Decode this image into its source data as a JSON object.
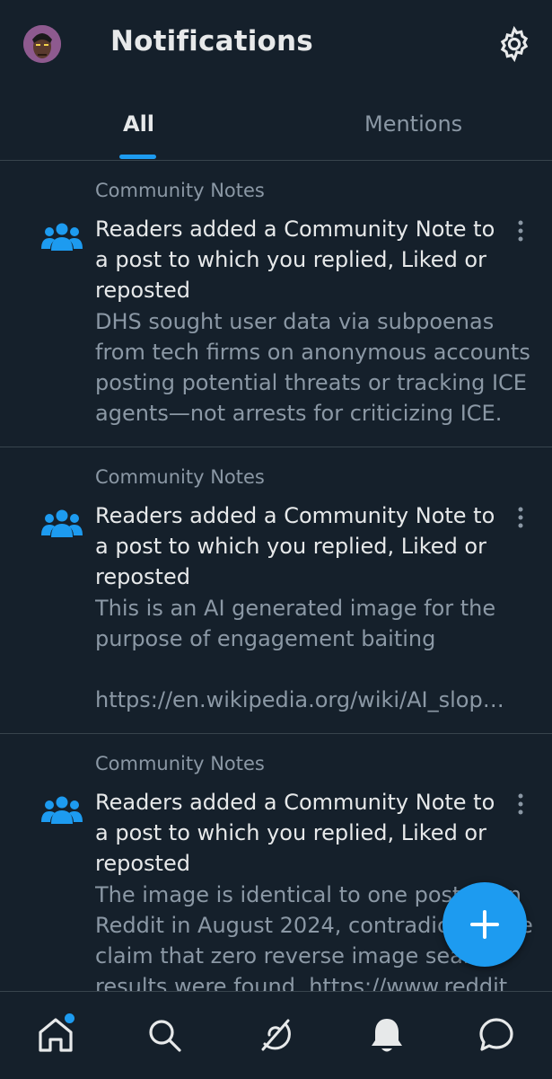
{
  "header": {
    "title": "Notifications",
    "avatar_icon": "avatar",
    "settings_icon": "gear-icon"
  },
  "tabs": [
    {
      "label": "All",
      "selected": true
    },
    {
      "label": "Mentions",
      "selected": false
    }
  ],
  "notifications": [
    {
      "source": "Community Notes",
      "headline": "Readers added a Community Note to a post to which you replied, Liked or reposted",
      "body": "DHS sought user data via subpoenas from tech firms on anonymous accounts posting potential threats or tracking ICE agents—not arrests for criticizing ICE. N…"
    },
    {
      "source": "Community Notes",
      "headline": "Readers added a Community Note to a post to which you replied, Liked or reposted",
      "body": "This is an AI generated image for the purpose of engagement baiting\n\nhttps://en.wikipedia.org/wiki/AI_slop…"
    },
    {
      "source": "Community Notes",
      "headline": "Readers added a Community Note to a post to which you replied, Liked or reposted",
      "body": "The image is identical to one posted on Reddit in August 2024, contradicting the claim that zero reverse image search results were found. https://www.reddit"
    }
  ],
  "fab": {
    "icon": "plus-icon"
  },
  "bottom_nav": [
    "home-icon",
    "search-icon",
    "grok-icon",
    "bell-icon",
    "messages-icon"
  ],
  "colors": {
    "accent": "#1d9bf0",
    "background": "#15202b",
    "muted": "#8b98a5"
  }
}
